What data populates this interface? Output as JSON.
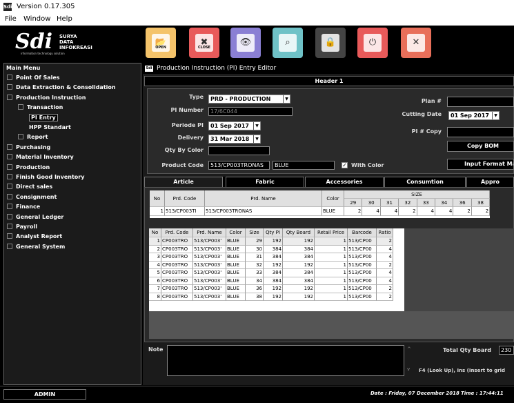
{
  "window": {
    "title": "Version 0.17.305",
    "icon_text": "Sdi"
  },
  "menu": [
    "File",
    "Window",
    "Help"
  ],
  "logo": {
    "mark": "Sdi",
    "line1": "SURYA",
    "line2": "DATA",
    "line3": "INFOKREASI",
    "tagline": "information technology solution"
  },
  "toolbar": [
    {
      "name": "open-icon",
      "label": "OPEN",
      "color": "#f4c36a"
    },
    {
      "name": "close-doc-icon",
      "label": "CLOSE",
      "color": "#e85a5a"
    },
    {
      "name": "view-icon",
      "label": "",
      "color": "#8a7fd4"
    },
    {
      "name": "preview-icon",
      "label": "",
      "color": "#6fc2c7"
    },
    {
      "name": "lock-icon",
      "label": "",
      "color": "#444444"
    },
    {
      "name": "power-icon",
      "label": "",
      "color": "#e85a5a"
    },
    {
      "name": "exit-icon",
      "label": "",
      "color": "#e86f5a"
    }
  ],
  "sidebar": {
    "title": "Main Menu",
    "items": [
      {
        "label": "Point Of Sales",
        "level": 0
      },
      {
        "label": "Data Extraction & Consolidation",
        "level": 0
      },
      {
        "label": "Production Instruction",
        "level": 0
      },
      {
        "label": "Transaction",
        "level": 1
      },
      {
        "label": "PI Entry",
        "level": 2,
        "selected": true
      },
      {
        "label": "HPP Standart",
        "level": 2
      },
      {
        "label": "Report",
        "level": 1
      },
      {
        "label": "Purchasing",
        "level": 0
      },
      {
        "label": "Material Inventory",
        "level": 0
      },
      {
        "label": "Production",
        "level": 0
      },
      {
        "label": "Finish Good Inventory",
        "level": 0
      },
      {
        "label": "Direct sales",
        "level": 0
      },
      {
        "label": "Consignment",
        "level": 0
      },
      {
        "label": "Finance",
        "level": 0
      },
      {
        "label": "General Ledger",
        "level": 0
      },
      {
        "label": "Payroll",
        "level": 0
      },
      {
        "label": "Analyst Report",
        "level": 0
      },
      {
        "label": "General System",
        "level": 0
      }
    ]
  },
  "editor": {
    "title": "Production Instruction (PI) Entry Editor",
    "header_tab": "Header 1",
    "form": {
      "type_label": "Type",
      "type_value": "PRD - PRODUCTION",
      "pi_number_label": "PI Number",
      "pi_number_value": "17/6C044",
      "periode_label": "Periode PI",
      "periode_value": "01 Sep 2017",
      "delivery_label": "Delivery",
      "delivery_value": "31 Mar 2018",
      "qty_by_color_label": "Qty By Color",
      "qty_by_color_value": "",
      "product_code_label": "Product Code",
      "product_code_value": "513/CP003TRONAS",
      "product_color_value": "BLUE",
      "with_color_label": "With Color",
      "with_color_checked": true,
      "plan_label": "Plan #",
      "plan_value": "",
      "cutting_date_label": "Cutting Date",
      "cutting_date_value": "01 Sep 2017",
      "pi_copy_label": "PI # Copy",
      "pi_copy_value": "",
      "copy_bom_label": "Copy BOM",
      "input_format_label": "Input Format Ma"
    },
    "tabs": [
      "Article",
      "Fabric",
      "Accessories",
      "Consumtion",
      "Appro"
    ],
    "article_grid": {
      "headers": [
        "No",
        "Prd. Code",
        "Prd. Name",
        "Color",
        "SIZE"
      ],
      "sizes": [
        "29",
        "30",
        "31",
        "32",
        "33",
        "34",
        "36",
        "38"
      ],
      "rows": [
        {
          "no": "1",
          "code": "513/CP003TI",
          "name": "513/CP003TRONAS",
          "color": "BLUE",
          "qty": [
            "2",
            "4",
            "4",
            "2",
            "4",
            "4",
            "2",
            "2"
          ]
        }
      ]
    },
    "detail_grid": {
      "headers": [
        "No",
        "Prd. Code",
        "Prd. Name",
        "Color",
        "Size",
        "Qty PI",
        "Qty Board",
        "Retail Price",
        "Barcode",
        "Ratio"
      ],
      "rows": [
        [
          "1",
          "CP003TRO",
          "513/CP003'",
          "BLUE",
          "29",
          "192",
          "192",
          "1",
          "513/CP00",
          "2"
        ],
        [
          "2",
          "CP003TRO",
          "513/CP003'",
          "BLUE",
          "30",
          "384",
          "384",
          "1",
          "513/CP00",
          "4"
        ],
        [
          "3",
          "CP003TRO",
          "513/CP003'",
          "BLUE",
          "31",
          "384",
          "384",
          "1",
          "513/CP00",
          "4"
        ],
        [
          "4",
          "CP003TRO",
          "513/CP003'",
          "BLUE",
          "32",
          "192",
          "192",
          "1",
          "513/CP00",
          "2"
        ],
        [
          "5",
          "CP003TRO",
          "513/CP003'",
          "BLUE",
          "33",
          "384",
          "384",
          "1",
          "513/CP00",
          "4"
        ],
        [
          "6",
          "CP003TRO",
          "513/CP003'",
          "BLUE",
          "34",
          "384",
          "384",
          "1",
          "513/CP00",
          "4"
        ],
        [
          "7",
          "CP003TRO",
          "513/CP003'",
          "BLUE",
          "36",
          "192",
          "192",
          "1",
          "513/CP00",
          "2"
        ],
        [
          "8",
          "CP003TRO",
          "513/CP003'",
          "BLUE",
          "38",
          "192",
          "192",
          "1",
          "513/CP00",
          "2"
        ]
      ]
    },
    "note_label": "Note",
    "total_qty_label": "Total Qty Board",
    "total_qty_value": "230",
    "hint": "F4 (Look Up), Ins (Insert to grid"
  },
  "status": {
    "user": "ADMIN",
    "date": "Date : Friday, 07 December 2018",
    "time": "Time : 17:44:11"
  }
}
